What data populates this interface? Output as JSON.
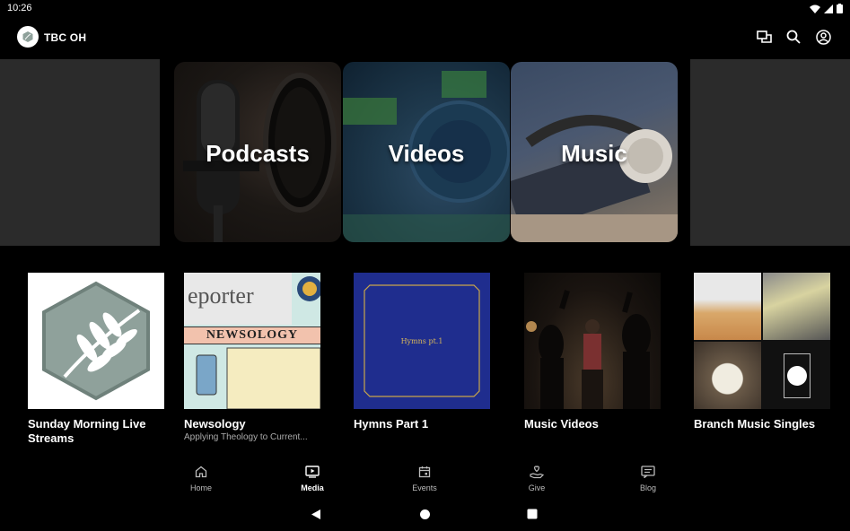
{
  "status_bar": {
    "time": "10:26"
  },
  "app_bar": {
    "title": "TBC OH"
  },
  "categories": [
    {
      "label": "Podcasts"
    },
    {
      "label": "Videos"
    },
    {
      "label": "Music"
    }
  ],
  "media_items": [
    {
      "title": "Sunday Morning Live Streams",
      "subtitle": ""
    },
    {
      "title": "Newsology",
      "subtitle": "Applying Theology to Current...",
      "art_text": "NEWSOLOGY",
      "art_text2": "eporter"
    },
    {
      "title": "Hymns Part 1",
      "subtitle": "",
      "art_text": "Hymns pt.1"
    },
    {
      "title": "Music Videos",
      "subtitle": ""
    },
    {
      "title": "Branch Music Singles",
      "subtitle": ""
    }
  ],
  "bottom_nav": {
    "items": [
      {
        "label": "Home",
        "icon": "home-icon"
      },
      {
        "label": "Media",
        "icon": "media-icon",
        "active": true
      },
      {
        "label": "Events",
        "icon": "calendar-icon"
      },
      {
        "label": "Give",
        "icon": "give-icon"
      },
      {
        "label": "Blog",
        "icon": "blog-icon"
      }
    ]
  },
  "colors": {
    "background": "#000000",
    "carousel_side": "#2b2b2b",
    "hymns_blue": "#1f2d8e",
    "sunday_sage": "#8fa19b"
  }
}
